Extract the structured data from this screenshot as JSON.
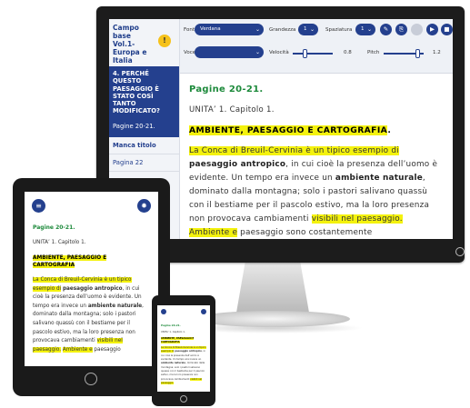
{
  "app": {
    "book_title": "Campo base Vol.1- Europa e Italia",
    "warning_glyph": "!",
    "active_chapter": "4. PERCHÉ QUESTO PAESAGGIO È STATO COSÌ TANTO MODIFICATO?",
    "active_pages": "Pagine 20-21.",
    "items": [
      {
        "label": "Manca titolo"
      },
      {
        "label": "Pagina 22"
      }
    ]
  },
  "toolbar": {
    "font_label": "Font",
    "font_value": "Verdana",
    "size_label": "Grandezza",
    "size_value": "1",
    "spacing_label": "Spaziatura",
    "spacing_value": "1",
    "voice_label": "Voce",
    "voice_value": "",
    "speed_label": "Velocità",
    "speed_value": "0.8",
    "pitch_label": "Pitch",
    "pitch_value": "1.2",
    "speed_level": 0.3,
    "pitch_level": 0.85
  },
  "content": {
    "pages": "Pagine 20-21.",
    "unit": "UNITA’ 1. Capitolo 1.",
    "unit_small": "UNITA’ 1. Capitolo 1.",
    "section": "AMBIENTE, PAESAGGIO E CARTOGRAFIA",
    "section_end": ".",
    "p1_hl": "La Conca di Breuil-Cervinia è un tipico esempio di",
    "p1_bold": "paesaggio antropico",
    "p1_rest": ", in cui cioè la presenza dell’uomo è evidente. Un tempo era invece un",
    "p2_bold": "ambiente naturale",
    "p2_rest": ", dominato dalla montagna; solo i pastori salivano quassù con il bestiame per il pascolo estivo, ma la loro presenza non provocava cambiamenti",
    "p3_hl": "visibili nel paesaggio.",
    "p4_hl": "Ambiente e",
    "p4_rest": "paesaggio sono costantemente"
  },
  "tablet": {
    "pages": "Pagine 20-21.",
    "unit": "UNITA’ 1. Capitolo 1.",
    "section": "AMBIENTE, PAESAGGIO E CARTOGRAFIA",
    "p1_hl": "La Conca di Breuil-Cervinia è un tipico esempio di",
    "p1_bold": "paesaggio antropico",
    "p1_rest": ", in cui cioè la presenza dell’uomo è evidente. Un tempo era invece un",
    "p2_bold": "ambiente naturale",
    "p2_rest": ", dominato dalla montagna; solo i pastori salivano quassù con il bestiame per il pascolo estivo, ma la loro presenza non provocava cambiamenti",
    "p3_hl": "visibili nel paesaggio.",
    "p4_hl": "Ambiente e",
    "p4_rest": "paesaggio"
  },
  "phone": {
    "pages": "Pagine 20-21.",
    "unit": "UNITA’ 1. Capitolo 1.",
    "section": "AMBIENTE, PAESAGGIO E CARTOGRAFIA",
    "p1_hl": "La Conca di Breuil-Cervinia è un tipico esempio di",
    "p1_bold": "paesaggio antropico",
    "p1_rest": ", in cui cioè la presenza dell’uomo è evidente. Un tempo era invece un",
    "p2_bold": "ambiente naturale",
    "p2_rest": ", dominato dalla montagna; solo i pastori salivano quassù con il bestiame per il pascolo estivo, ma la loro presenza non provocava cambiamenti",
    "p3_hl": "visibili nel paesaggio."
  },
  "icons": {
    "menu": "≡",
    "gear": "✹",
    "chevron": "⌄",
    "edit": "✎",
    "copy": "⎘",
    "play": "▶",
    "stop": "■"
  },
  "colors": {
    "accent": "#24408e",
    "highlight": "#f4f20d",
    "heading_green": "#1d8a3b"
  }
}
